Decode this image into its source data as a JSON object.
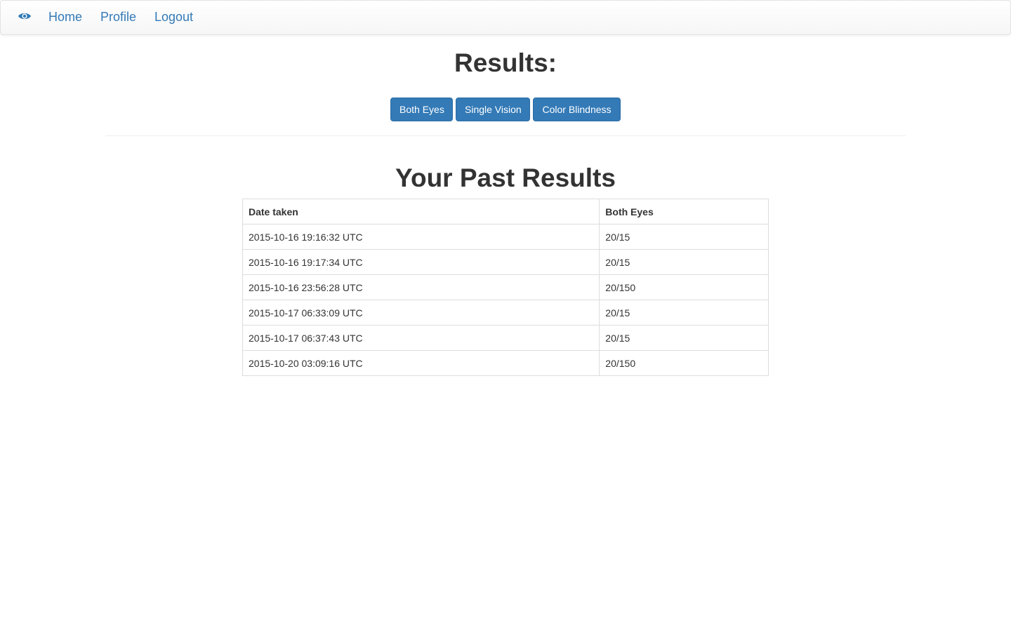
{
  "nav": {
    "brand_icon": "eye-icon",
    "brand_color": "#337ab7",
    "home": "Home",
    "profile": "Profile",
    "logout": "Logout"
  },
  "results_title": "Results:",
  "buttons": {
    "both_eyes": "Both Eyes",
    "single_vision": "Single Vision",
    "color_blindness": "Color Blindness",
    "color": "#337ab7"
  },
  "past_results": {
    "title": "Your Past Results",
    "columns": [
      "Date taken",
      "Both Eyes"
    ],
    "rows": [
      {
        "date": "2015-10-16 19:16:32 UTC",
        "value": "20/15"
      },
      {
        "date": "2015-10-16 19:17:34 UTC",
        "value": "20/15"
      },
      {
        "date": "2015-10-16 23:56:28 UTC",
        "value": "20/150"
      },
      {
        "date": "2015-10-17 06:33:09 UTC",
        "value": "20/15"
      },
      {
        "date": "2015-10-17 06:37:43 UTC",
        "value": "20/15"
      },
      {
        "date": "2015-10-20 03:09:16 UTC",
        "value": "20/150"
      }
    ]
  }
}
